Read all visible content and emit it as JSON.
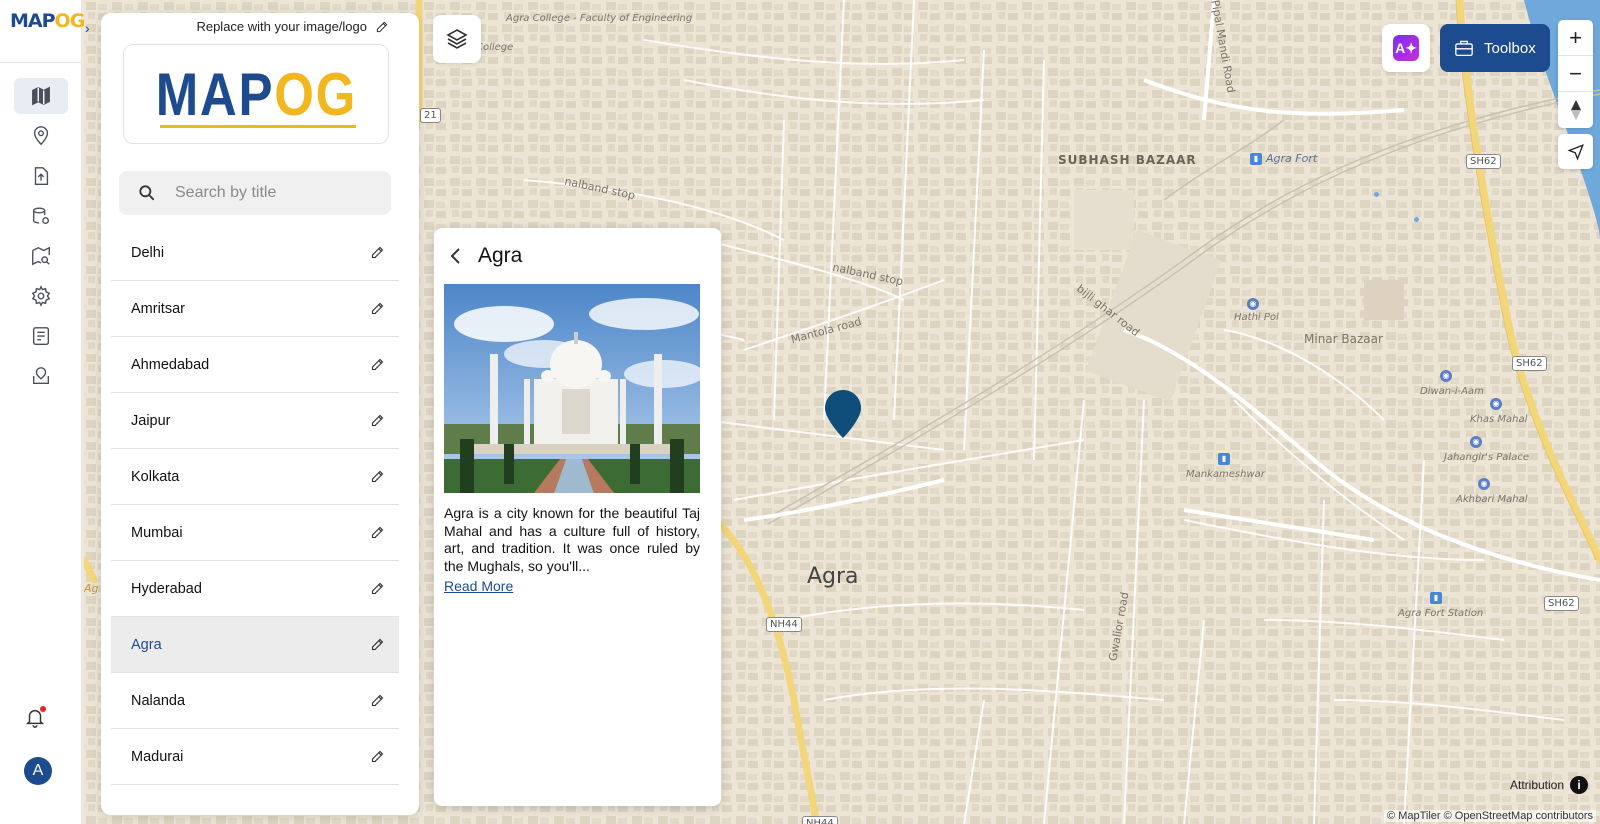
{
  "rail": {
    "logo_main": "MAP",
    "logo_accent": "OG",
    "expand_icon": "chevron-right-icon",
    "items": [
      {
        "icon": "map-icon",
        "active": true
      },
      {
        "icon": "location-pin-icon",
        "active": false
      },
      {
        "icon": "file-upload-icon",
        "active": false
      },
      {
        "icon": "database-settings-icon",
        "active": false
      },
      {
        "icon": "map-search-icon",
        "active": false
      },
      {
        "icon": "gear-icon",
        "active": false
      },
      {
        "icon": "checklist-icon",
        "active": false
      },
      {
        "icon": "map-check-icon",
        "active": false
      }
    ],
    "avatar_initial": "A"
  },
  "panel": {
    "replace_logo_text": "Replace with your image/logo",
    "logo_main": "MAP",
    "logo_accent": "OG",
    "search_placeholder": "Search by title",
    "items": [
      {
        "name": "Delhi",
        "active": false
      },
      {
        "name": "Amritsar",
        "active": false
      },
      {
        "name": "Ahmedabad",
        "active": false
      },
      {
        "name": "Jaipur",
        "active": false
      },
      {
        "name": "Kolkata",
        "active": false
      },
      {
        "name": "Mumbai",
        "active": false
      },
      {
        "name": "Hyderabad",
        "active": false
      },
      {
        "name": "Agra",
        "active": true
      },
      {
        "name": "Nalanda",
        "active": false
      },
      {
        "name": "Madurai",
        "active": false
      }
    ]
  },
  "popup": {
    "title": "Agra",
    "description": "Agra is a city known for the beautiful Taj Mahal and has a culture full of history, art, and tradition. It was once ruled by the Mughals, so you'll...",
    "read_more": "Read More",
    "image_subject": "Taj Mahal photo"
  },
  "map": {
    "labels": {
      "agra_college": "Agra College - Faculty of Engineering",
      "college": "College",
      "subhash_bazaar": "SUBHASH BAZAAR",
      "agra_fort": "Agra Fort",
      "nalband_stop_1": "nalband stop",
      "nalband_stop_2": "nalband stop",
      "mantola_road": "Mantola road",
      "bijli_ghar_road": "bijli ghar road",
      "hathi_pol": "Hathi Pol",
      "minar_bazaar": "Minar Bazaar",
      "diwan_i_aam": "Diwan-i-Aam",
      "khas_mahal": "Khas Mahal",
      "jahangirs_palace": "Jahangir's Palace",
      "akhbari_mahal": "Akhbari Mahal",
      "mankameshwar": "Mankameshwar",
      "agra": "Agra",
      "gwalior_road": "Gwalior road",
      "agra_fort_station": "Agra Fort Station",
      "pipal_mandi_road": "Pipal Mandi Road",
      "agra_left": "Ag"
    },
    "shields": {
      "sh62_a": "SH62",
      "sh62_b": "SH62",
      "sh62_c": "SH62",
      "nh44_a": "NH44",
      "nh44_b": "NH44",
      "r21": "21"
    },
    "marker_color": "#0f4d7a"
  },
  "controls": {
    "ai_label": "A",
    "toolbox_label": "Toolbox",
    "zoom_in": "+",
    "zoom_out": "−",
    "attribution": "Attribution",
    "attribution_icon": "i",
    "copyright": "© MapTiler © OpenStreetMap contributors"
  },
  "colors": {
    "brand": "#1d4b8f",
    "accent": "#f2b61e",
    "map_bg": "#ece5d6",
    "major_road": "#f3d57a",
    "river": "#6fa9dc"
  }
}
